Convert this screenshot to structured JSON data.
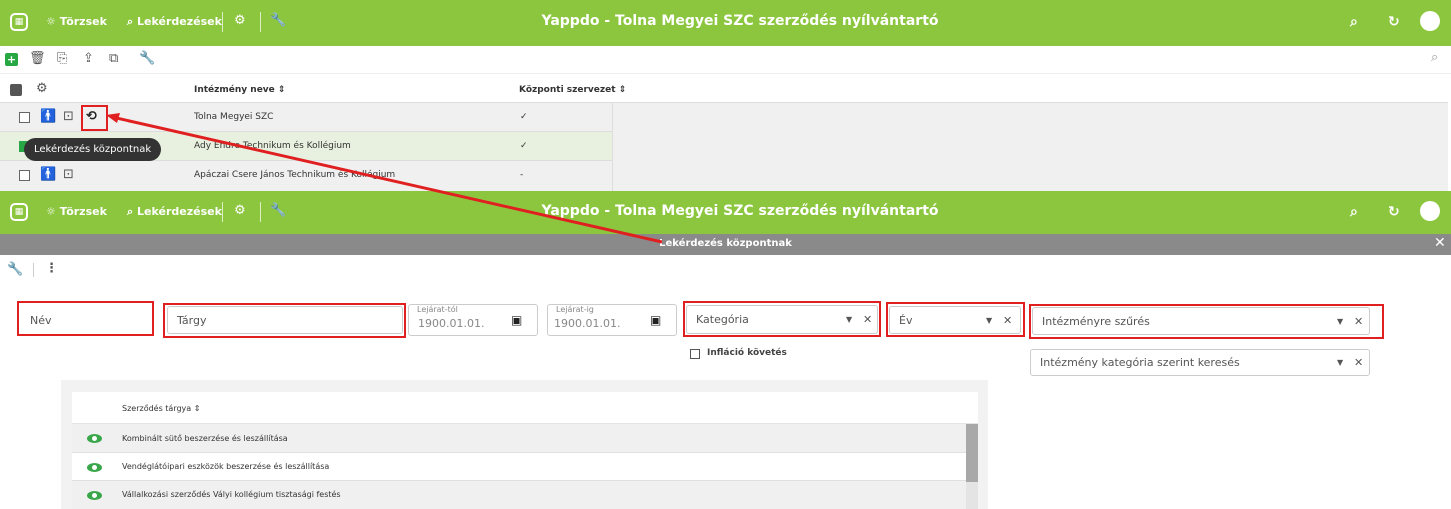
{
  "app": {
    "title": "Yappdo - Tolna Megyei SZC szerződés nyílvántartó",
    "nav_torzsek": "Törzsek",
    "nav_lekerdezesek": "Lekérdezések"
  },
  "list": {
    "col_name": "Intézmény neve",
    "col_central": "Központi szervezet",
    "rows": [
      {
        "name": "Tolna Megyei SZC",
        "central": "✓"
      },
      {
        "name": "Ady Endre Technikum és Kollégium",
        "central": "✓"
      },
      {
        "name": "Apáczai Csere János Technikum és Kollégium",
        "central": "-"
      }
    ],
    "tooltip": "Lekérdezés központnak"
  },
  "dialog": {
    "title": "Lekérdezés központnak",
    "filters": {
      "nev": "Név",
      "targy": "Tárgy",
      "lejarat_tol_label": "Lejárat-tól",
      "lejarat_tol_value": "1900.01.01.",
      "lejarat_ig_label": "Lejárat-ig",
      "lejarat_ig_value": "1900.01.01.",
      "kategoria": "Kategória",
      "ev": "Év",
      "intezmeny_szures": "Intézményre szűrés",
      "intezmeny_kategoria": "Intézmény kategória szerint keresés",
      "inflacio": "Infláció követés"
    },
    "table": {
      "col_subject": "Szerződés tárgya",
      "rows": [
        "Kombinált sütő beszerzése és leszállítása",
        "Vendéglátóipari eszközök beszerzése és leszállítása",
        "Vállalkozási szerződés Vályi kollégium tisztasági festés"
      ]
    }
  },
  "colors": {
    "brand_green": "#8cc63f",
    "annotation_red": "#e02020",
    "eye_green": "#3aa64a"
  }
}
